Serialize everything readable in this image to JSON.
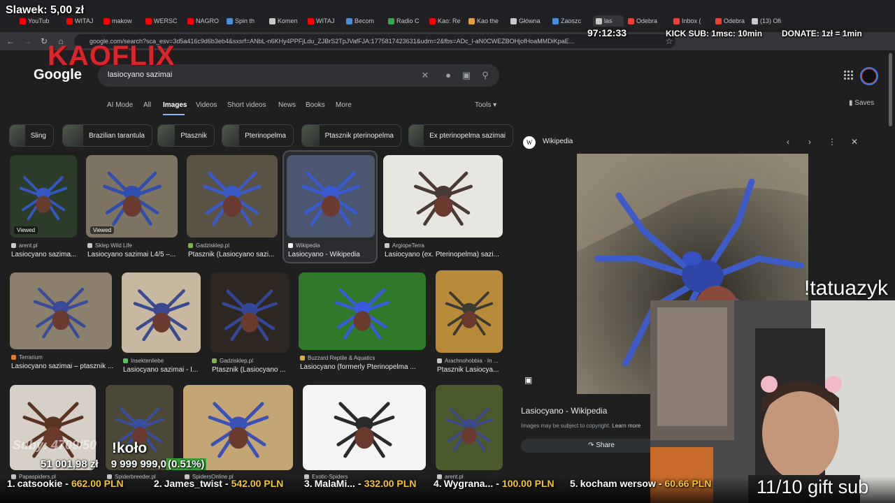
{
  "browser": {
    "tabs": [
      {
        "label": "YouTub",
        "color": "#ff0000"
      },
      {
        "label": "WITAJ",
        "color": "#ff0000"
      },
      {
        "label": "makow",
        "color": "#ff0000"
      },
      {
        "label": "WERSC",
        "color": "#ff0000"
      },
      {
        "label": "NAGRO",
        "color": "#ff0000"
      },
      {
        "label": "Spin th",
        "color": "#4a90d9"
      },
      {
        "label": "Komen",
        "color": "#c8c8c8"
      },
      {
        "label": "WITAJ",
        "color": "#ff0000"
      },
      {
        "label": "Becom",
        "color": "#4a90d9"
      },
      {
        "label": "Radio C",
        "color": "#34a853"
      },
      {
        "label": "Kao: Re",
        "color": "#ff0000"
      },
      {
        "label": "Kao the",
        "color": "#e0a040"
      },
      {
        "label": "Główna",
        "color": "#c8c8c8"
      },
      {
        "label": "Zaoszc",
        "color": "#4a90d9"
      },
      {
        "label": "las",
        "color": "#c8c8c8",
        "active": true
      },
      {
        "label": "Odebra",
        "color": "#ea4335"
      },
      {
        "label": "Inbox (",
        "color": "#ea4335"
      },
      {
        "label": "Odebra",
        "color": "#ea4335"
      },
      {
        "label": "(13) Ofi",
        "color": "#c8c8c8"
      }
    ],
    "url": "google.com/search?sca_esv=3d5a416c9d6b3eb4&sxsrf=ANbL-n6KHy4PPFjLdu_ZJBrS2TpJVafFJA:1775817423631&udm=2&fbs=ADc_l-aN0CWEZBOHjofHoaMMDiKpaE..."
  },
  "google": {
    "logo": "Google",
    "query": "lasiocyano sazimai",
    "tabs": [
      "AI Mode",
      "All",
      "Images",
      "Videos",
      "Short videos",
      "News",
      "Books",
      "More"
    ],
    "active_tab": "Images",
    "tools": "Tools",
    "saves": "Saves",
    "chips": [
      "Sling",
      "Brazilian tarantula",
      "Ptasznik",
      "Pterinopelma",
      "Ptasznik pterinopelma",
      "Ex pterinopelma sazimai"
    ]
  },
  "results": [
    {
      "source": "arent.pl",
      "caption": "Lasiocyano sazima...",
      "viewed": true,
      "src_color": "#c8c8c8"
    },
    {
      "source": "Sklep Wild Life",
      "caption": "Lasiocyano sazimai L4/5 –...",
      "viewed": true,
      "src_color": "#c8c8c8"
    },
    {
      "source": "Gadzisklep.pl",
      "caption": "Ptasznik (Lasiocyano sazi...",
      "viewed": false,
      "src_color": "#7fb348"
    },
    {
      "source": "Wikipedia",
      "caption": "Lasiocyano - Wikipedia",
      "viewed": false,
      "src_color": "#ffffff"
    },
    {
      "source": "ArgiopeTerra",
      "caption": "Lasiocyano (ex. Pterinopelma) sazi...",
      "viewed": false,
      "src_color": "#c8c8c8"
    },
    {
      "source": "Terrarium",
      "caption": "Lasiocyano sazimai – ptasznik ...",
      "viewed": false,
      "src_color": "#e07a2a"
    },
    {
      "source": "Insektenliebe",
      "caption": "Lasiocyano sazimai - I...",
      "viewed": false,
      "src_color": "#5bbf5b"
    },
    {
      "source": "Gadzisklep.pl",
      "caption": "Ptasznik (Lasiocyano ...",
      "viewed": false,
      "src_color": "#7fb348"
    },
    {
      "source": "Buzzard Reptile & Aquatics",
      "caption": "Lasiocyano (formerly Pterinopelma ...",
      "viewed": false,
      "src_color": "#e0b020"
    },
    {
      "source": "Arachnohobbia · In ...",
      "caption": "Ptasznik Lasiocya...",
      "viewed": false,
      "src_color": "#c8c8c8"
    },
    {
      "source": "Papaspiders.pl",
      "caption": "",
      "viewed": false,
      "src_color": "#c8c8c8"
    },
    {
      "source": "Spiderbreeder.pl",
      "caption": "",
      "viewed": false,
      "src_color": "#c8c8c8"
    },
    {
      "source": "SpidersOnline.pl",
      "caption": "",
      "viewed": false,
      "src_color": "#c8c8c8"
    },
    {
      "source": "Exotic-Spiders",
      "caption": "",
      "viewed": false,
      "src_color": "#c8c8c8"
    },
    {
      "source": "arent.pl",
      "caption": "",
      "viewed": false,
      "src_color": "#c8c8c8"
    }
  ],
  "panel": {
    "site": "Wikipedia",
    "site_letter": "W",
    "title": "Lasiocyano - Wikipedia",
    "note": "Images may be subject to copyright.",
    "learn_more": "Learn more",
    "share": "Share"
  },
  "stream": {
    "top_donor": "Slawek: 5,00 zł",
    "timer": "97:12:33",
    "kick_sub": "KICK SUB: 1msc: 10min",
    "donate": "DONATE: 1zł = 1min",
    "brand": "KAOFLIX",
    "command": "!tatuazyk",
    "subs": "Suby: 4709/50",
    "kolo": "!koło",
    "goal_current": "51 001,98 zł",
    "goal_target": "9 999 999,0",
    "goal_pct": "(0.51%)",
    "gift": "11/10 gift sub",
    "leaderboard": [
      {
        "rank": "1.",
        "name": "catsookie",
        "amount": "662.00 PLN"
      },
      {
        "rank": "2.",
        "name": "James_twist",
        "amount": "542.00 PLN"
      },
      {
        "rank": "3.",
        "name": "MalaMi...",
        "amount": "332.00 PLN"
      },
      {
        "rank": "4.",
        "name": "Wygrana...",
        "amount": "100.00 PLN"
      },
      {
        "rank": "5.",
        "name": "kocham wersow",
        "amount": "60.66 PLN"
      }
    ]
  }
}
